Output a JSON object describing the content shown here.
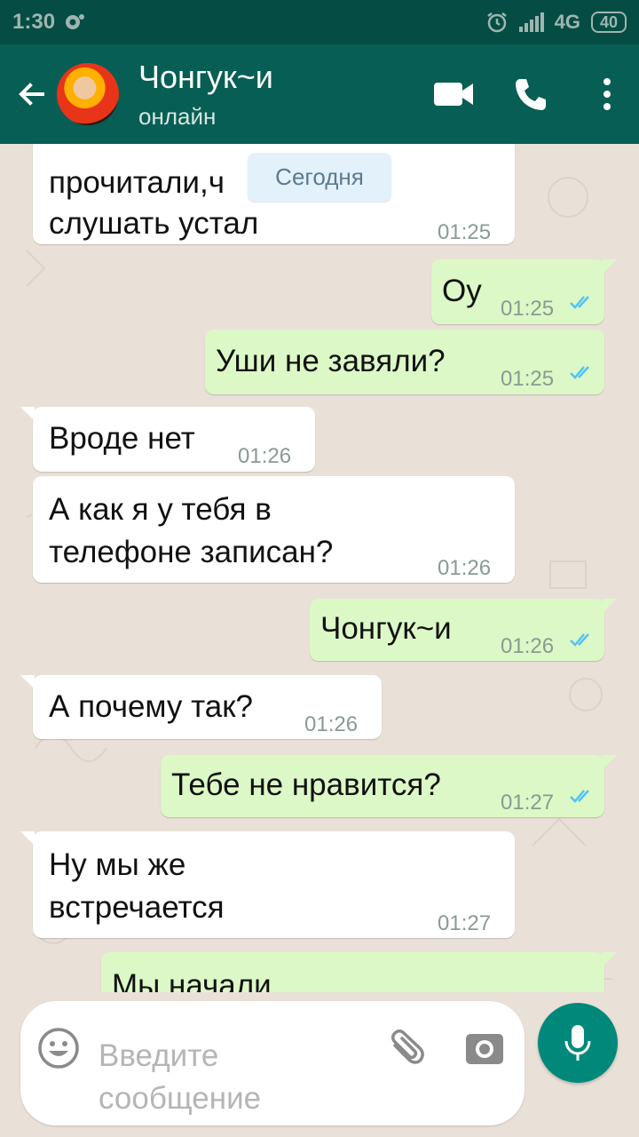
{
  "status_bar": {
    "time": "1:30",
    "network": "4G",
    "battery": "40"
  },
  "header": {
    "contact_name": "Чонгук~и",
    "contact_status": "онлайн"
  },
  "date_chip": "Сегодня",
  "messages": [
    {
      "direction": "in",
      "line1": "прочитали,ч",
      "line2": "слушать устал",
      "time": "01:25"
    },
    {
      "direction": "out",
      "text": "Оу",
      "time": "01:25",
      "read": true
    },
    {
      "direction": "out",
      "text": "Уши не завяли?",
      "time": "01:25",
      "read": true
    },
    {
      "direction": "in",
      "text": "Вроде нет",
      "time": "01:26"
    },
    {
      "direction": "in",
      "line1": "А как я у тебя в",
      "line2": "телефоне записан?",
      "time": "01:26"
    },
    {
      "direction": "out",
      "text": "Чонгук~и",
      "time": "01:26",
      "read": true
    },
    {
      "direction": "in",
      "text": "А почему так?",
      "time": "01:26"
    },
    {
      "direction": "out",
      "text": "Тебе не нравится?",
      "time": "01:27",
      "read": true
    },
    {
      "direction": "in",
      "line1": "Ну мы же",
      "line2": "встречается",
      "time": "01:27"
    },
    {
      "direction": "out",
      "text": "Мы начали",
      "time": ""
    }
  ],
  "composer": {
    "placeholder_line1": "Введите",
    "placeholder_line2": "сообщение"
  },
  "colors": {
    "header": "#075e54",
    "status_bar": "#054d44",
    "outgoing_bubble": "#dcf8c6",
    "incoming_bubble": "#ffffff",
    "accent": "#00897b",
    "read_ticks": "#4fc3f7"
  },
  "icons": [
    "back-arrow-icon",
    "video-call-icon",
    "phone-icon",
    "more-vert-icon",
    "emoji-icon",
    "attach-icon",
    "camera-icon",
    "mic-icon",
    "read-ticks-icon"
  ]
}
